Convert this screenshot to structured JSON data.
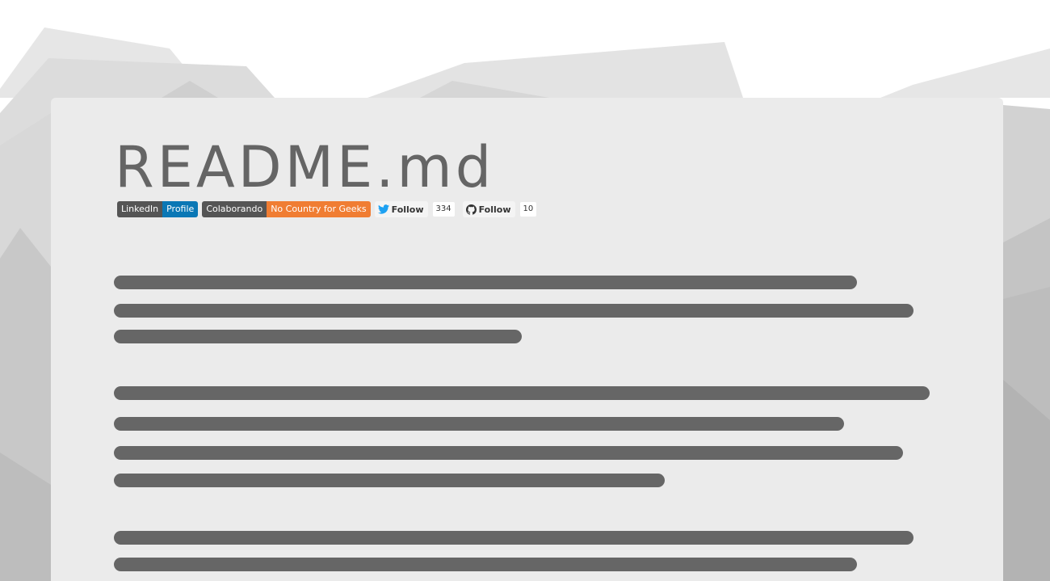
{
  "page": {
    "title": "README.md"
  },
  "badges": {
    "linkedin": {
      "label": "LinkedIn",
      "value": "Profile"
    },
    "colaborando": {
      "label": "Colaborando",
      "value": "No Country for Geeks"
    },
    "twitter": {
      "label": "Follow",
      "count": "334"
    },
    "github": {
      "label": "Follow",
      "count": "10"
    }
  },
  "colors": {
    "card_background": "#ebebeb",
    "title_text": "#656565",
    "placeholder_line": "#666666",
    "linkedin_blue": "#0a77b5",
    "orange": "#f07d33",
    "twitter_blue": "#1da1f2"
  },
  "icons": {
    "twitter": "twitter-bird-icon",
    "github": "github-octocat-icon"
  }
}
